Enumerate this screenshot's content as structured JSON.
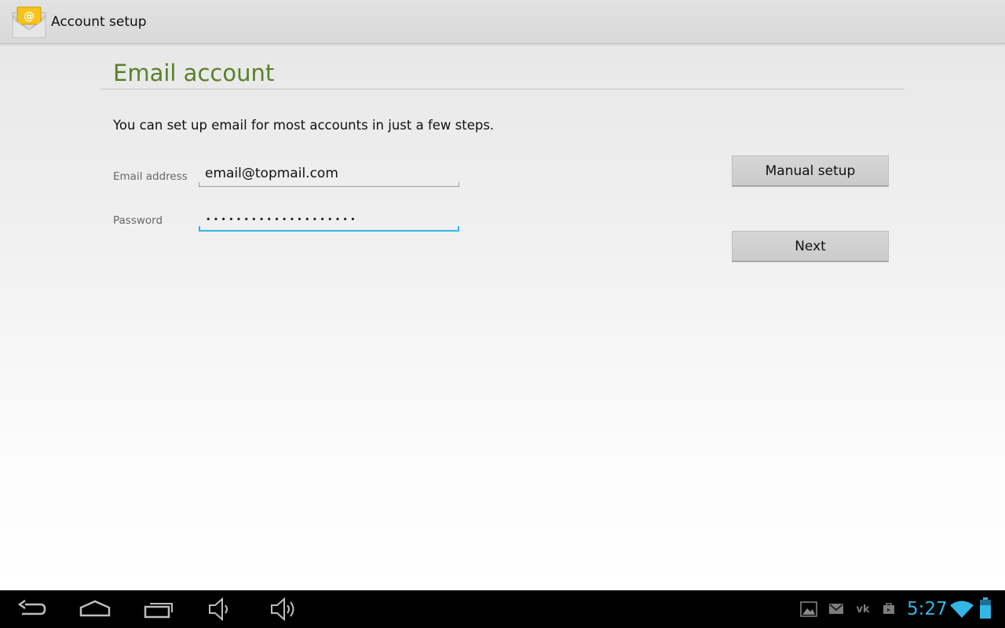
{
  "action_bar": {
    "title": "Account setup",
    "icon": "email-envelope-icon"
  },
  "page": {
    "section_title": "Email account",
    "instructions": "You can set up email for most accounts in just a few steps."
  },
  "form": {
    "email_label": "Email address",
    "email_value": "email@topmail.com",
    "password_label": "Password",
    "password_masked": "••••••••••••••••••••",
    "password_length": 20,
    "focused_field": "password"
  },
  "buttons": {
    "manual_setup": "Manual setup",
    "next": "Next"
  },
  "nav_bar": {
    "buttons": [
      "back-icon",
      "home-icon",
      "recent-apps-icon",
      "volume-down-icon",
      "volume-up-icon"
    ]
  },
  "status_bar": {
    "time": "5:27",
    "notification_icons": [
      "gallery-icon",
      "gmail-icon",
      "vk-icon",
      "store-bag-icon"
    ],
    "wifi": "full",
    "battery": "charging",
    "accent_color": "#33b5e5"
  }
}
